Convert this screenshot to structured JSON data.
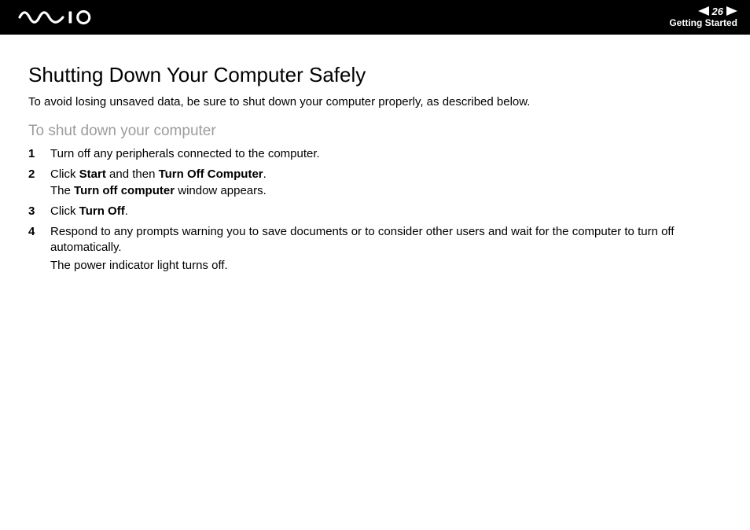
{
  "header": {
    "page_number": "26",
    "section": "Getting Started"
  },
  "content": {
    "title": "Shutting Down Your Computer Safely",
    "intro": "To avoid losing unsaved data, be sure to shut down your computer properly, as described below.",
    "subheading": "To shut down your computer",
    "steps": {
      "s1": "Turn off any peripherals connected to the computer.",
      "s2a": "Click ",
      "s2b": "Start",
      "s2c": " and then ",
      "s2d": "Turn Off Computer",
      "s2e": ".",
      "s2f": "The ",
      "s2g": "Turn off computer",
      "s2h": " window appears.",
      "s3a": "Click ",
      "s3b": "Turn Off",
      "s3c": ".",
      "s4a": "Respond to any prompts warning you to save documents or to consider other users and wait for the computer to turn off automatically.",
      "s4b": "The power indicator light turns off."
    }
  }
}
